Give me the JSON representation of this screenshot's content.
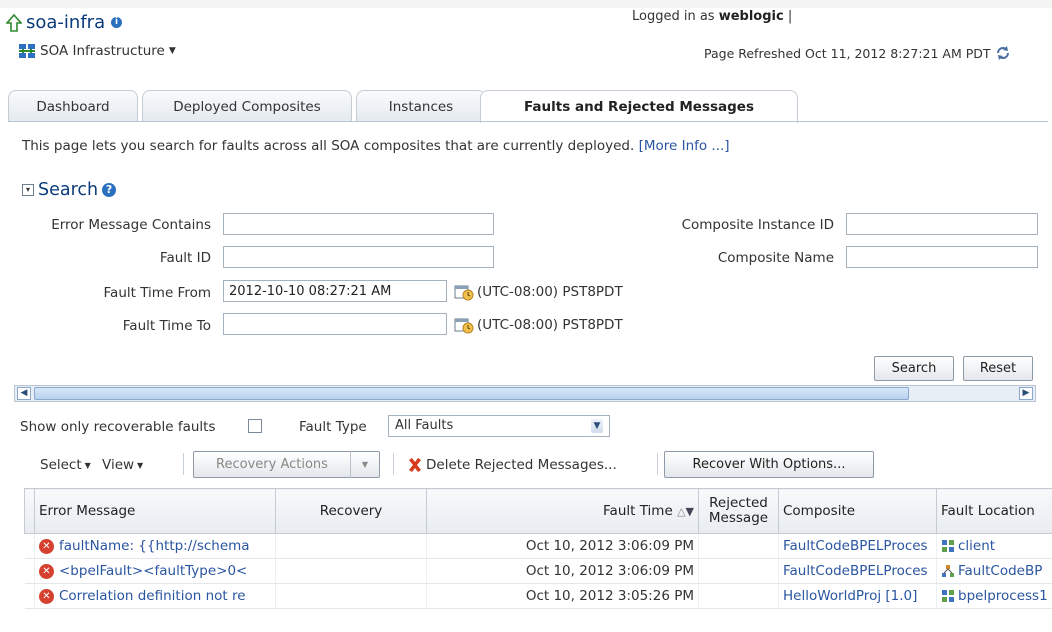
{
  "header": {
    "app_title": "soa-infra",
    "logged_in_prefix": "Logged in as",
    "user": "weblogic",
    "menu_label": "SOA Infrastructure",
    "refreshed": "Page Refreshed Oct 11, 2012 8:27:21 AM PDT"
  },
  "tabs": [
    {
      "label": "Dashboard"
    },
    {
      "label": "Deployed Composites"
    },
    {
      "label": "Instances"
    },
    {
      "label": "Faults and Rejected Messages"
    }
  ],
  "description": {
    "text": "This page lets you search for faults across all SOA composites that are currently deployed.",
    "more_info": "[More Info ...]"
  },
  "search": {
    "title": "Search",
    "fields": {
      "error_message_label": "Error Message Contains",
      "error_message_value": "",
      "fault_id_label": "Fault ID",
      "fault_id_value": "",
      "fault_time_from_label": "Fault Time From",
      "fault_time_from_value": "2012-10-10 08:27:21 AM",
      "fault_time_to_label": "Fault Time To",
      "fault_time_to_value": "",
      "timezone": "(UTC-08:00) PST8PDT",
      "instance_id_label": "Composite Instance ID",
      "instance_id_value": "",
      "composite_name_label": "Composite Name",
      "composite_name_value": ""
    },
    "search_button": "Search",
    "reset_button": "Reset"
  },
  "filters": {
    "recoverable_label": "Show only recoverable faults",
    "recoverable_checked": false,
    "fault_type_label": "Fault Type",
    "fault_type_value": "All Faults"
  },
  "toolbar": {
    "select": "Select",
    "view": "View",
    "recovery_actions": "Recovery Actions",
    "delete": "Delete Rejected Messages...",
    "recover_options": "Recover With Options..."
  },
  "table": {
    "columns": [
      "Error Message",
      "Recovery",
      "Fault Time",
      "Rejected Message",
      "Composite",
      "Fault Location"
    ],
    "rows": [
      {
        "error": "faultName: {{http://schema",
        "recovery": "",
        "time": "Oct 10, 2012 3:06:09 PM",
        "rejected": "",
        "composite": "FaultCodeBPELProces",
        "location": "client"
      },
      {
        "error": "<bpelFault><faultType>0<",
        "recovery": "",
        "time": "Oct 10, 2012 3:06:09 PM",
        "rejected": "",
        "composite": "FaultCodeBPELProces",
        "location": "FaultCodeBP"
      },
      {
        "error": "Correlation definition not re",
        "recovery": "",
        "time": "Oct 10, 2012 3:05:26 PM",
        "rejected": "",
        "composite": "HelloWorldProj [1.0]",
        "location": "bpelprocess1"
      }
    ]
  },
  "colors": {
    "link": "#2a55a0",
    "title": "#0b3b7a",
    "error": "#d6412f"
  }
}
